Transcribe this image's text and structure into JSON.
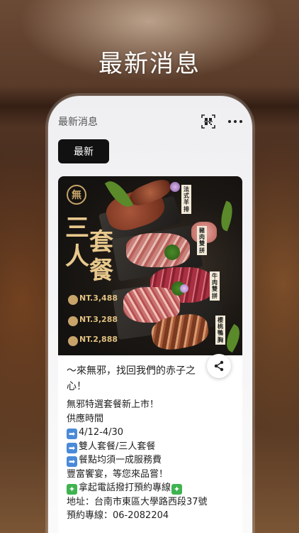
{
  "headline": "最新消息",
  "app": {
    "title": "最新消息",
    "tab_label": "最新"
  },
  "promo_image": {
    "logo": "無",
    "vertical_title": [
      "三",
      "人",
      "套",
      "餐"
    ],
    "prices": [
      "NT.3,488",
      "NT.3,288",
      "NT.2,888"
    ],
    "tags": [
      "法式羊排",
      "豬肉雙拼",
      "牛肉雙拼",
      "櫻桃鴨胸"
    ]
  },
  "post": {
    "title": "～來無邪，找回我們的赤子之心！",
    "lines": [
      {
        "icon": "",
        "text": "無邪特選套餐新上市！"
      },
      {
        "icon": "",
        "text": "供應時間"
      },
      {
        "icon": "arrow-right-icon",
        "text": "4/12-4/30"
      },
      {
        "icon": "arrow-right-icon",
        "text": "雙人套餐/三人套餐"
      },
      {
        "icon": "arrow-right-icon",
        "text": "餐點均須一成服務費"
      },
      {
        "icon": "",
        "text": "豐富饗宴，等您來品嘗！"
      },
      {
        "icon": "sparkle-icon",
        "text": "拿起電話撥打預約專線"
      },
      {
        "icon": "",
        "text": "地址：台南市東區大學路西段37號"
      },
      {
        "icon": "",
        "text": "預約專線：06-2082204"
      }
    ]
  },
  "colors": {
    "tab_bg": "#111111",
    "gold": "#c8a46a",
    "arrow_icon": "#4a8ad8",
    "sparkle_icon": "#3fb34f"
  }
}
